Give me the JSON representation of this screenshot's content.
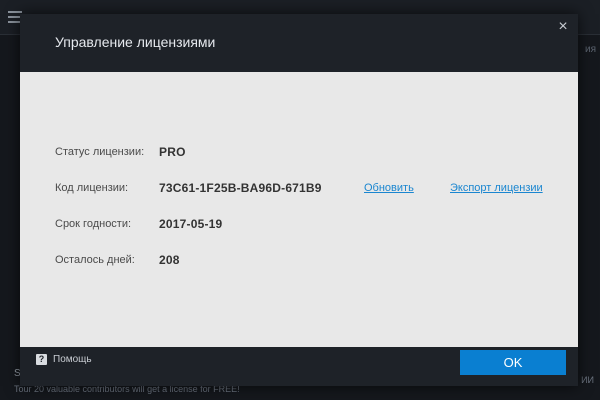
{
  "background": {
    "right_text": "ия",
    "bottom_left_text": "S",
    "bottom_text": "Tour 20 valuable contributors will get a license for FREE!",
    "bottom_right_text": "ИИ"
  },
  "dialog": {
    "title": "Управление лицензиями",
    "close_label": "×",
    "rows": [
      {
        "label": "Статус лицензии:",
        "value": "PRO"
      },
      {
        "label": "Код лицензии:",
        "value": "73C61-1F25B-BA96D-671B9"
      },
      {
        "label": "Срок годности:",
        "value": "2017-05-19"
      },
      {
        "label": "Осталось дней:",
        "value": "208"
      }
    ],
    "links": {
      "refresh": "Обновить",
      "export": "Экспорт лицензии"
    },
    "footer": {
      "help_icon": "?",
      "help_label": "Помощь",
      "ok_label": "OK"
    }
  },
  "colors": {
    "accent": "#0a7fd1",
    "link": "#1a86d0",
    "dialog_dark": "#1e2228",
    "body_light": "#e8e8e8"
  }
}
